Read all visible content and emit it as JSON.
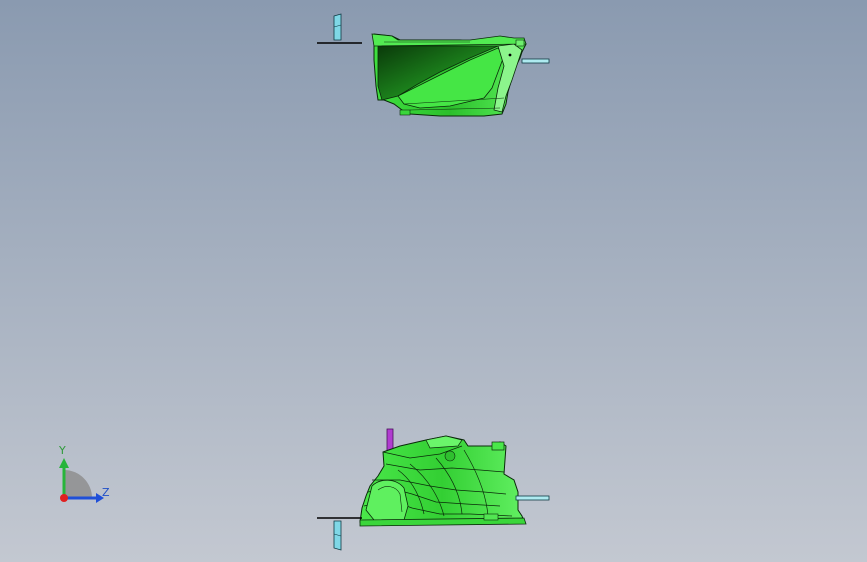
{
  "triad": {
    "y_label": "Y",
    "z_label": "Z",
    "colors": {
      "y_axis": "#27b53a",
      "z_axis": "#1f4fd8",
      "x_axis": "#e02020",
      "plane": "#888888"
    }
  },
  "scene": {
    "icons": [
      "part-top-view-icon",
      "part-bottom-view-icon",
      "pin-icon",
      "marker-icon"
    ],
    "colors": {
      "part": "#3ad63a",
      "part_dark": "#0f4d0f",
      "edge": "#0a2a0a",
      "pin": "#aeeaf0",
      "marker": "#b03cd0"
    }
  }
}
